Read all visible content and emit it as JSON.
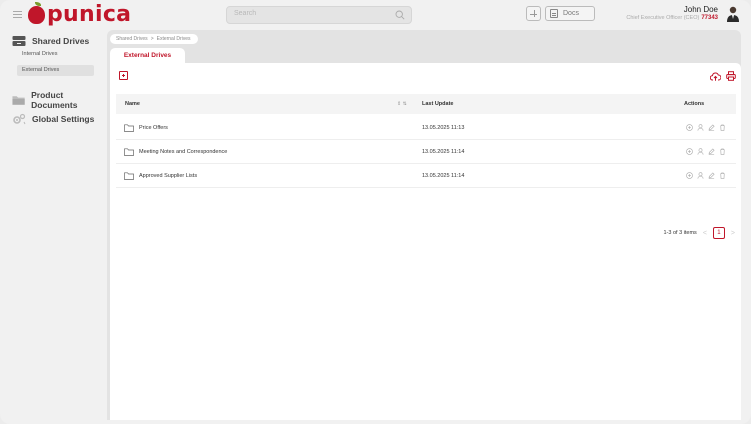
{
  "header": {
    "brand": "punica",
    "search_placeholder": "Search",
    "docs_label": "Docs",
    "user_name": "John Doe",
    "user_role": "Chief Executive Officer (CEO)",
    "user_ext": "77343"
  },
  "sidebar": {
    "sections": [
      {
        "label": "Shared Drives",
        "icon": "drive-icon"
      },
      {
        "label": "Product Documents",
        "icon": "folder-icon"
      },
      {
        "label": "Global Settings",
        "icon": "gear-icon"
      }
    ],
    "sub_items": [
      {
        "label": "Internal Drives",
        "active": false
      },
      {
        "label": "External Drives",
        "active": true
      }
    ]
  },
  "breadcrumb": [
    "Shared Drives",
    ">",
    "External Drives"
  ],
  "tab": "External Drives",
  "table": {
    "columns": [
      "Name",
      "Last Update",
      "Actions"
    ],
    "rows": [
      {
        "name": "Price Offers",
        "date": "13.05.2025 11:13"
      },
      {
        "name": "Meeting Notes and Correspondence",
        "date": "13.05.2025 11:14"
      },
      {
        "name": "Approved Supplier Lists",
        "date": "13.05.2025 11:14"
      }
    ]
  },
  "pagination": {
    "summary": "1-3 of 3 items",
    "prev": "<",
    "current": "1",
    "next": ">"
  },
  "colors": {
    "accent": "#c0162a"
  }
}
